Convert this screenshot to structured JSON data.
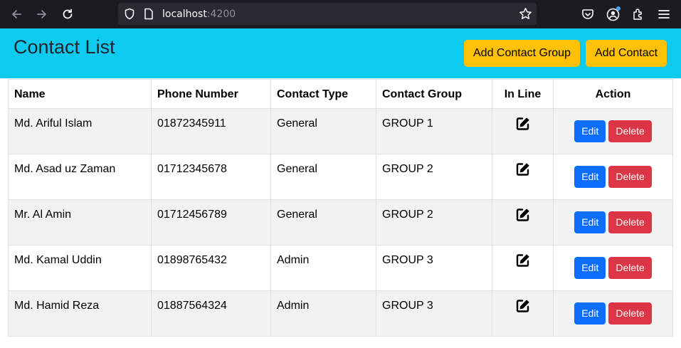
{
  "browser": {
    "url_host": "localhost",
    "url_port": ":4200"
  },
  "header": {
    "title": "Contact List",
    "add_group_label": "Add Contact Group",
    "add_contact_label": "Add Contact"
  },
  "table": {
    "columns": [
      "Name",
      "Phone Number",
      "Contact Type",
      "Contact Group",
      "In Line",
      "Action"
    ],
    "rows": [
      {
        "name": "Md. Ariful Islam",
        "phone": "01872345911",
        "type": "General",
        "group": "GROUP 1"
      },
      {
        "name": "Md. Asad uz Zaman",
        "phone": "01712345678",
        "type": "General",
        "group": "GROUP 2"
      },
      {
        "name": "Mr. Al Amin",
        "phone": "01712456789",
        "type": "General",
        "group": "GROUP 2"
      },
      {
        "name": "Md. Kamal Uddin",
        "phone": "01898765432",
        "type": "Admin",
        "group": "GROUP 3"
      },
      {
        "name": "Md. Hamid Reza",
        "phone": "01887564324",
        "type": "Admin",
        "group": "GROUP 3"
      }
    ],
    "edit_label": "Edit",
    "delete_label": "Delete",
    "inline_icon": "pen-to-square-icon"
  },
  "colors": {
    "header_bg": "#0dcaf0",
    "header_button": "#ffc107",
    "edit_button": "#0d6efd",
    "delete_button": "#dc3545"
  }
}
